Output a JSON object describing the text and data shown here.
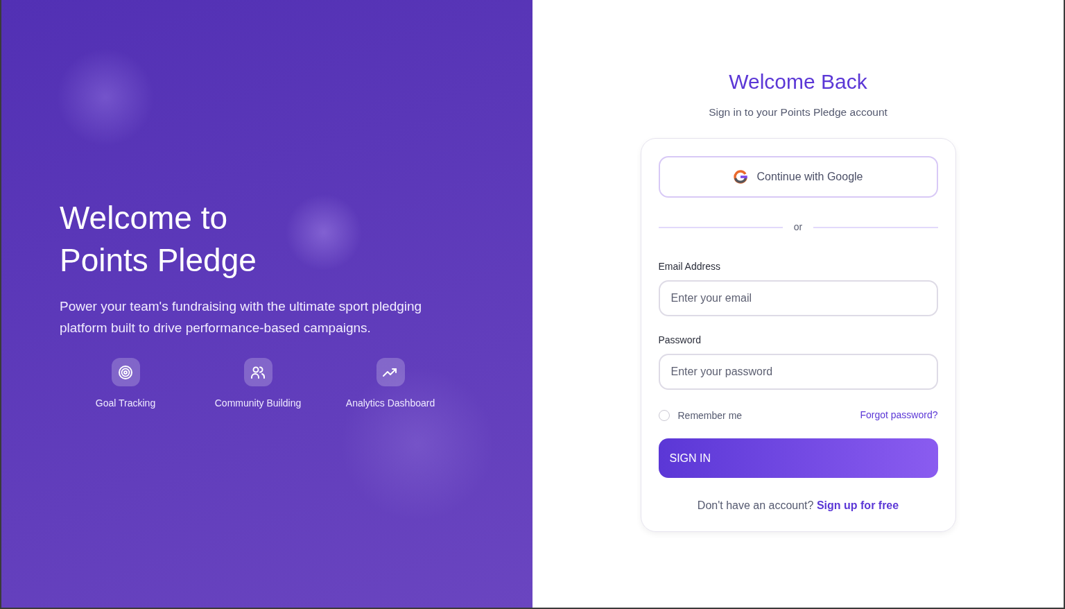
{
  "hero": {
    "title": "Welcome to Points Pledge",
    "subtitle": "Power your team's fundraising with the ultimate sport pledging platform built to drive performance-based campaigns.",
    "features": [
      {
        "kind": "target",
        "label": "Goal Tracking"
      },
      {
        "kind": "people",
        "label": "Community Building"
      },
      {
        "kind": "trend",
        "label": "Analytics Dashboard"
      }
    ]
  },
  "login": {
    "title": "Welcome Back",
    "subtitle": "Sign in to your Points Pledge account",
    "google_button": "Continue with Google",
    "divider": "or",
    "fields": [
      {
        "label": "Email Address",
        "placeholder": "Enter your email"
      },
      {
        "label": "Password",
        "placeholder": "Enter your password"
      }
    ],
    "remember": {
      "label": "Remember me",
      "checked": false
    },
    "forgot_link": "Forgot password?",
    "submit": "SIGN IN",
    "signup_prompt": "Don't have an account?",
    "signup_link": "Sign up for free"
  }
}
